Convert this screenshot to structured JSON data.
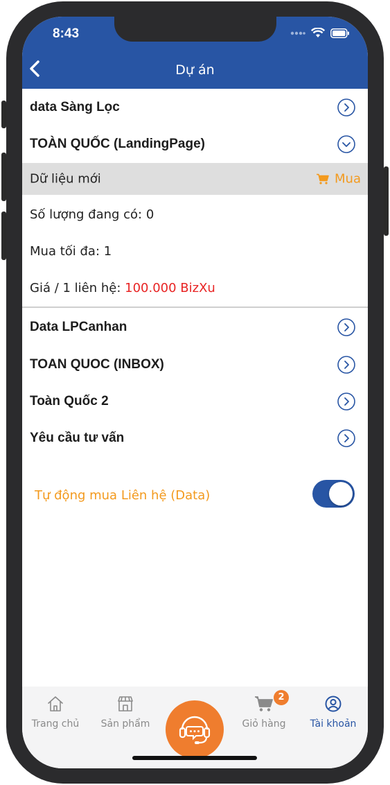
{
  "status_bar": {
    "time": "8:43"
  },
  "header": {
    "title": "Dự án"
  },
  "rows": [
    {
      "label": "data Sàng Lọc"
    },
    {
      "label": "TOÀN QUỐC (LandingPage)"
    },
    {
      "label": "Data LPCanhan"
    },
    {
      "label": "TOAN QUOC (INBOX)"
    },
    {
      "label": "Toàn Quốc 2"
    },
    {
      "label": "Yêu cầu tư vấn"
    }
  ],
  "expanded": {
    "sub_label": "Dữ liệu mới",
    "buy_label": "Mua",
    "quantity_text": "Số lượng đang có: 0",
    "max_text": "Mua tối đa: 1",
    "price_prefix": "Giá / 1 liên hệ: ",
    "price_value": "100.000 BizXu"
  },
  "toggle": {
    "label": "Tự động mua Liên hệ (Data)",
    "on": true
  },
  "tabbar": {
    "tabs": [
      {
        "label": "Trang chủ",
        "icon": "home-icon"
      },
      {
        "label": "Sản phẩm",
        "icon": "store-icon"
      },
      {
        "label": "Giỏ hàng",
        "icon": "cart-icon"
      },
      {
        "label": "Tài khoản",
        "icon": "account-icon"
      }
    ],
    "cart_badge": "2",
    "center_icon": "support-headset-icon"
  },
  "colors": {
    "primary": "#2855a4",
    "accent": "#f39a1e",
    "price": "#e82424",
    "tab_center": "#ef7d2e"
  }
}
